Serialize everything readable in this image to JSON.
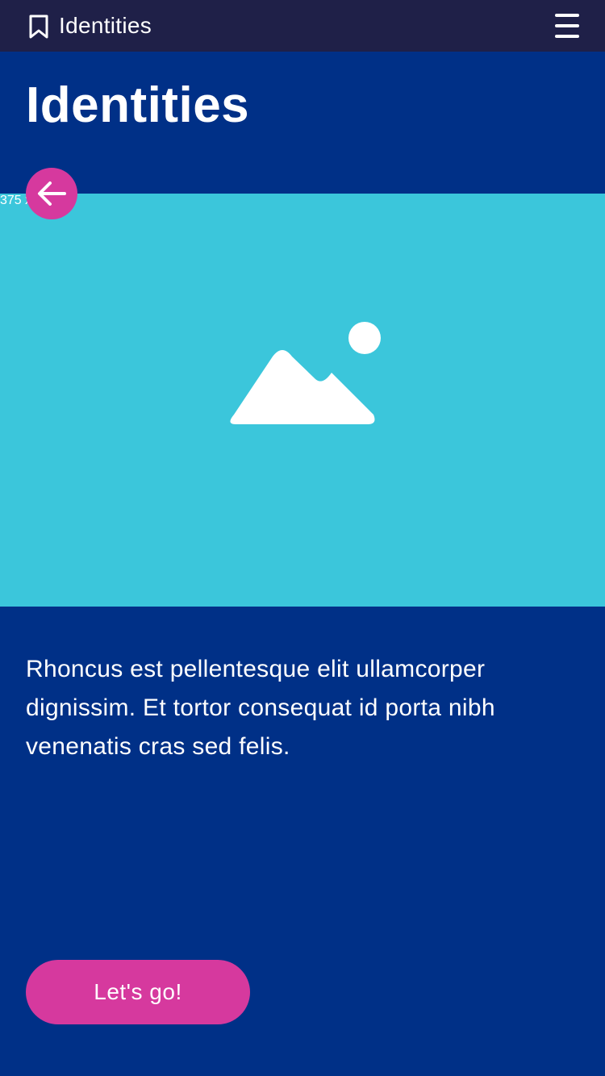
{
  "header": {
    "app_title": "Identities",
    "bookmark_icon": "bookmark-icon",
    "menu_icon": "hamburger-menu-icon"
  },
  "page": {
    "title": "Identities"
  },
  "image_placeholder": {
    "dimensions_label": "375 x 256",
    "icon": "image-placeholder-icon"
  },
  "back_button": {
    "icon": "arrow-left-icon"
  },
  "content": {
    "body": "Rhoncus est pellentesque elit ullamcorper dignissim. Et tortor consequat id porta nibh venenatis cras sed felis."
  },
  "cta": {
    "label": "Let's go!"
  },
  "colors": {
    "topbar": "#1f2048",
    "primary_background": "#003087",
    "image_background": "#3bc6db",
    "accent": "#d6399e",
    "text": "#ffffff"
  }
}
